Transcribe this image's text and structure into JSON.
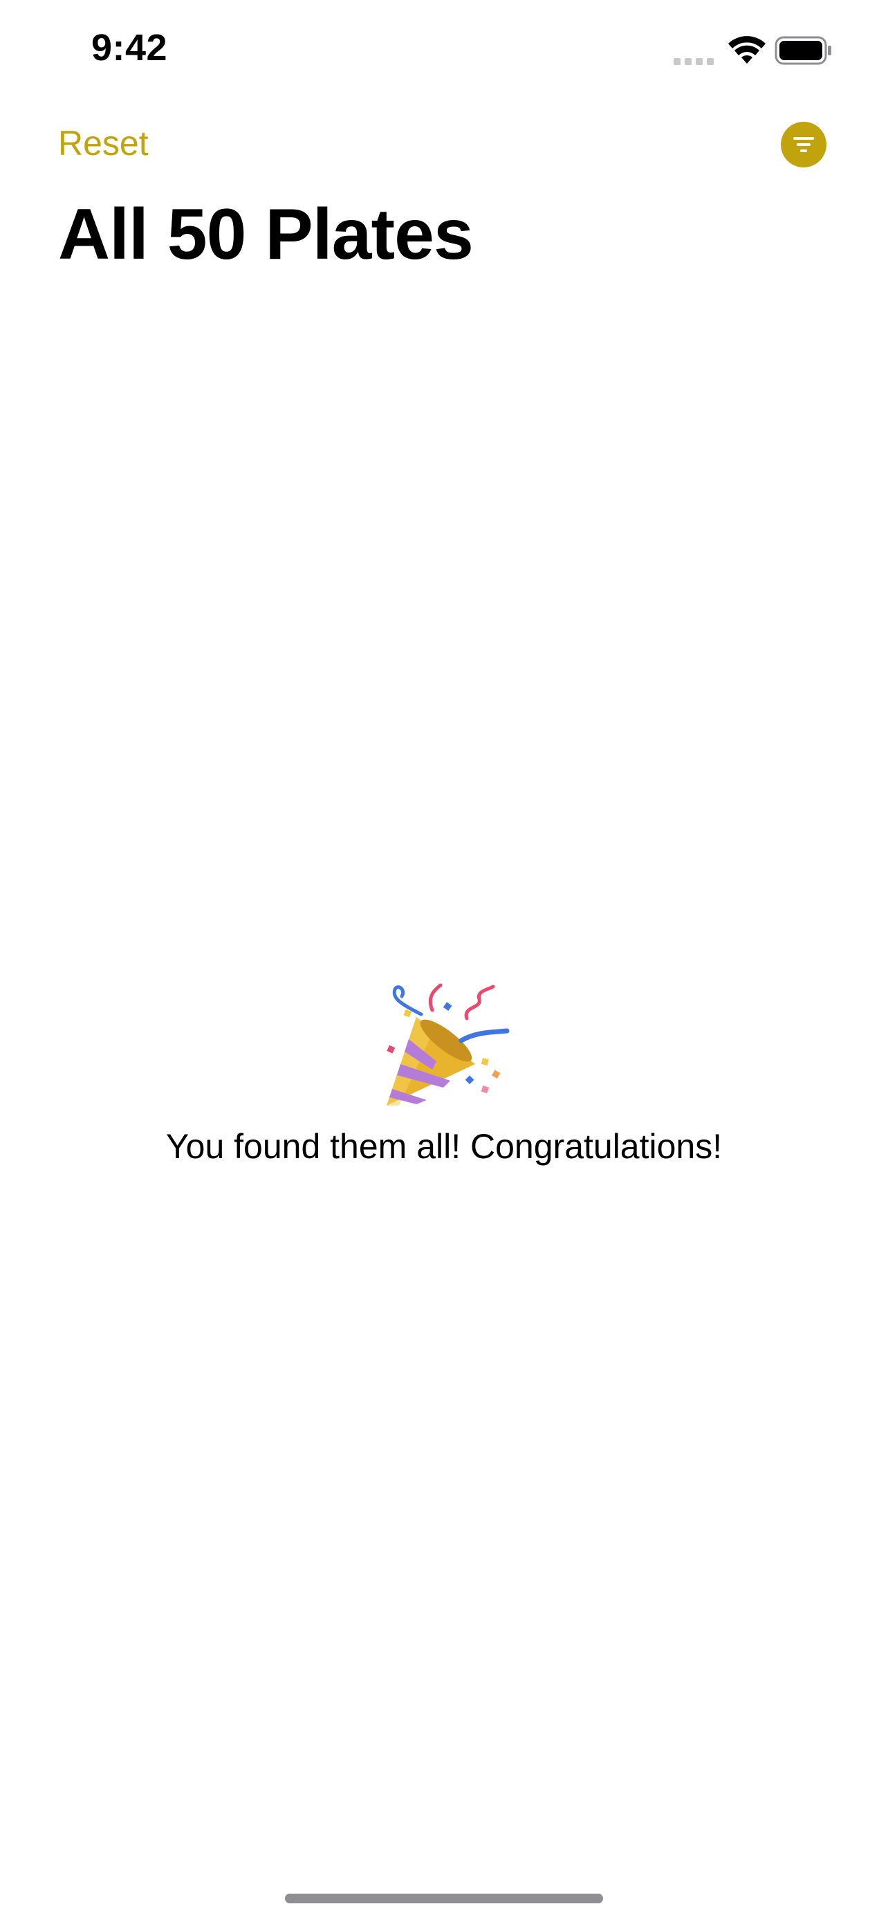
{
  "status_bar": {
    "time": "9:42"
  },
  "nav": {
    "reset_label": "Reset",
    "filter_icon": "line-3-horizontal-decrease-circle-fill",
    "accent_color": "#c1a30e"
  },
  "header": {
    "title": "All 50 Plates"
  },
  "content": {
    "emoji_icon": "party-popper",
    "message": "You found them all! Congratulations!"
  }
}
